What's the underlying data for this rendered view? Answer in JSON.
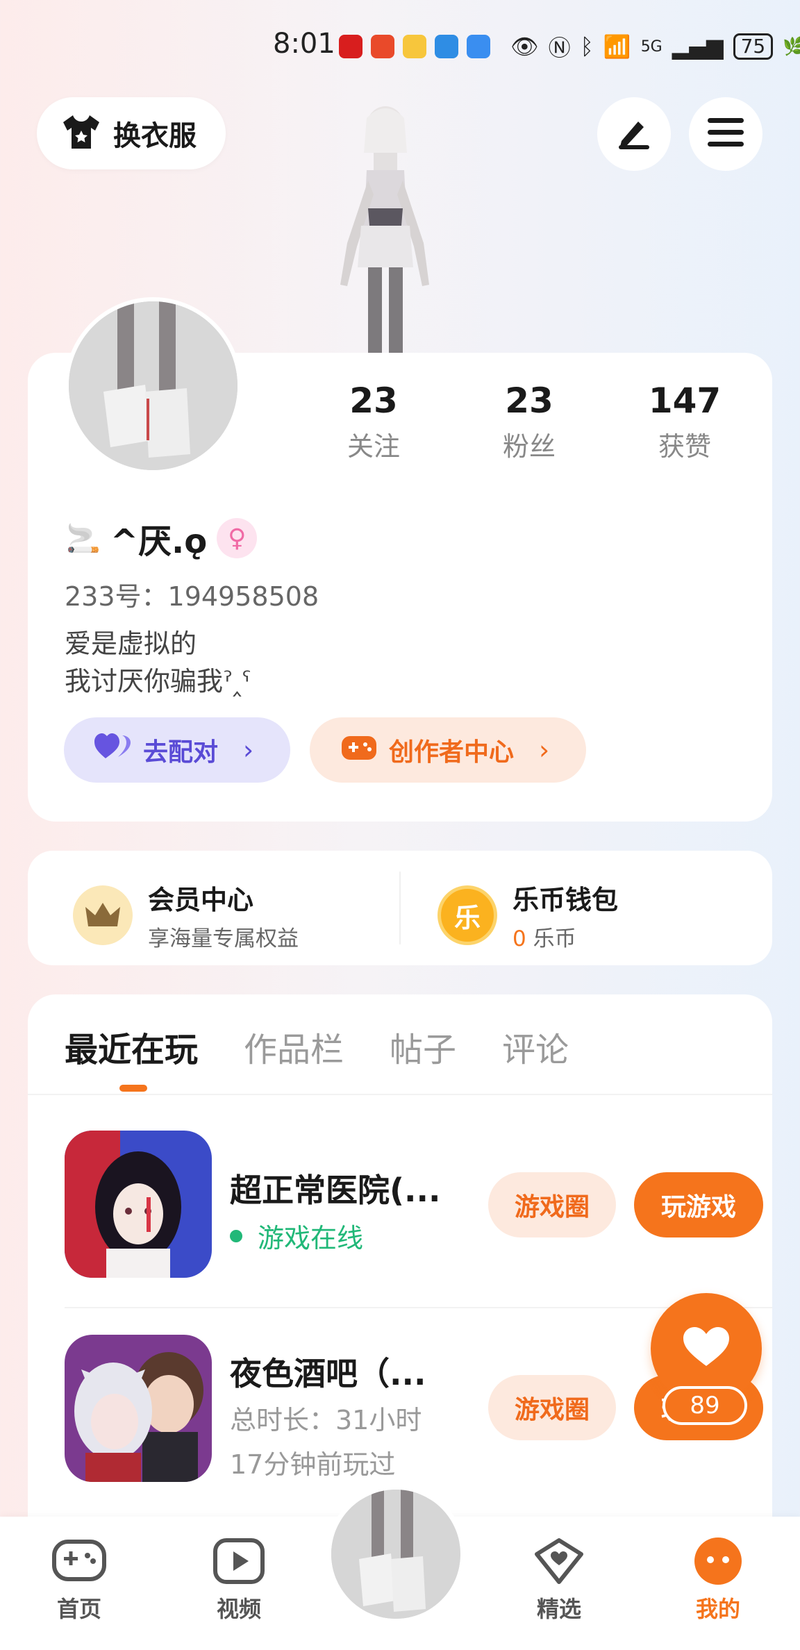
{
  "status_bar": {
    "time": "8:01",
    "network": "5G",
    "battery": "75"
  },
  "header": {
    "outfit_label": "换衣服",
    "edit_icon": "pencil-icon",
    "menu_icon": "hamburger-icon"
  },
  "profile": {
    "stats": [
      {
        "value": "23",
        "label": "关注"
      },
      {
        "value": "23",
        "label": "粉丝"
      },
      {
        "value": "147",
        "label": "获赞"
      }
    ],
    "name": "^厌.ǫ",
    "name_prefix_emoji": "🚬",
    "gender_symbol": "♀",
    "uid": "233号：194958508",
    "bio_line1": "爱是虚拟的",
    "bio_line2": "我讨厌你骗我ˀ‸ˁ",
    "match_label": "去配对",
    "creator_label": "创作者中心"
  },
  "member": {
    "vip_title": "会员中心",
    "vip_sub": "享海量专属权益",
    "wallet_title": "乐币钱包",
    "wallet_icon_char": "乐",
    "wallet_amount": "0",
    "wallet_unit": "乐币"
  },
  "tabs": [
    "最近在玩",
    "作品栏",
    "帖子",
    "评论"
  ],
  "games": [
    {
      "title": "超正常医院(...",
      "status": "游戏在线",
      "circle_label": "游戏圈",
      "play_label": "玩游戏"
    },
    {
      "title": "夜色酒吧（...",
      "duration": "总时长：31小时",
      "last_played": "17分钟前玩过",
      "circle_label": "游戏圈",
      "play_label": "玩游戏"
    }
  ],
  "float_like": {
    "count": "89"
  },
  "nav": {
    "home": "首页",
    "video": "视频",
    "featured": "精选",
    "mine": "我的"
  },
  "colors": {
    "accent": "#f5741c",
    "match_bg": "#e5e4fb",
    "match_fg": "#5a4bd6",
    "online": "#21b878"
  }
}
